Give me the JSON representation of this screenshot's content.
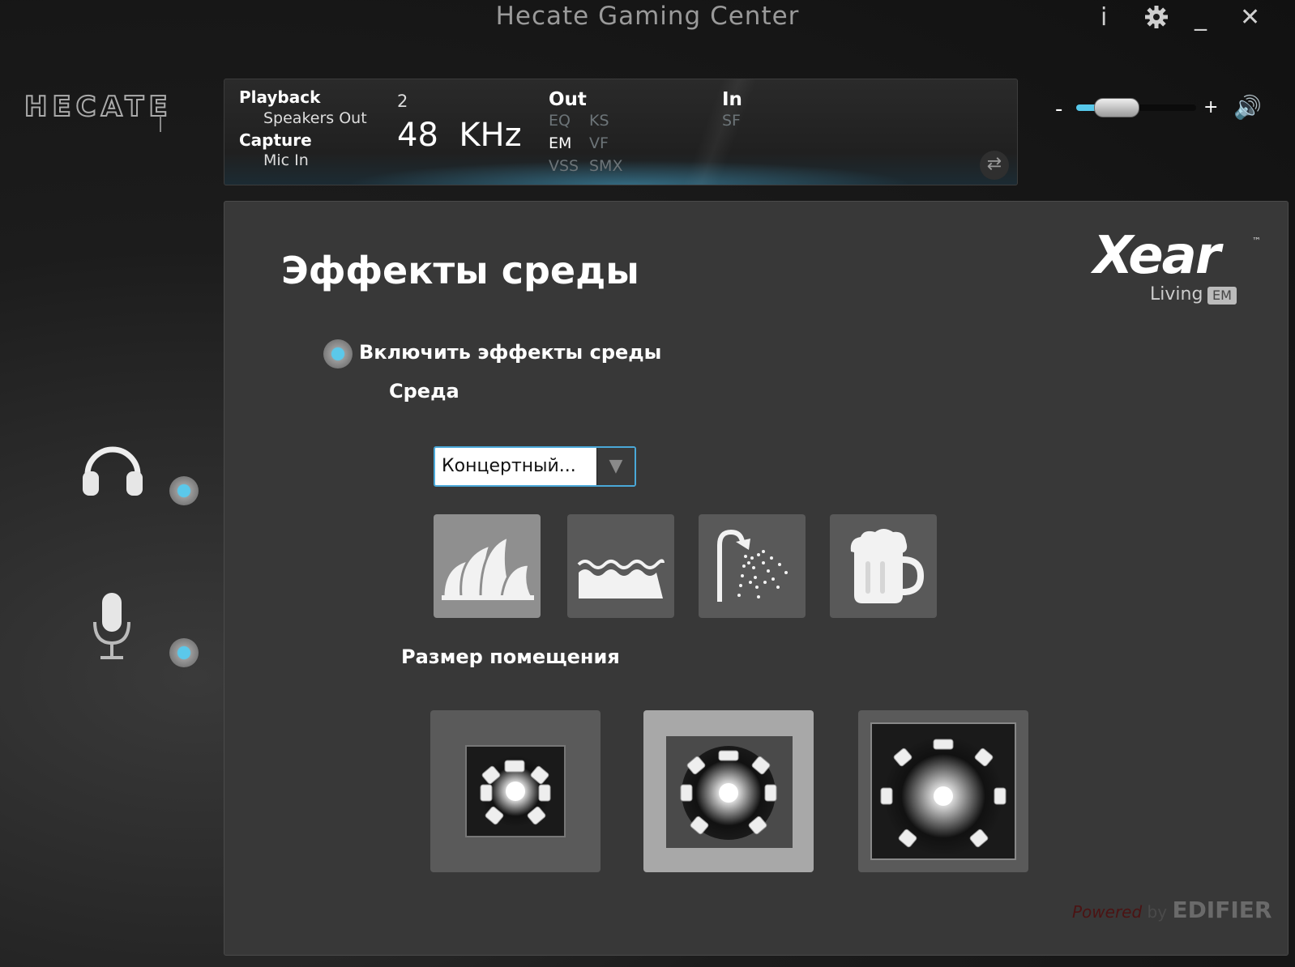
{
  "window": {
    "title": "Hecate Gaming Center",
    "controls": {
      "info": "i",
      "minimize": "_",
      "close": "✕"
    }
  },
  "brand": {
    "logo_text": "HECATE"
  },
  "status": {
    "playback_label": "Playback",
    "playback_device": "Speakers Out",
    "capture_label": "Capture",
    "capture_device": "Mic In",
    "channels": "2",
    "sample_rate": "48  KHz",
    "out_label": "Out",
    "out_effects": [
      "EQ",
      "KS",
      "EM",
      "VF",
      "VSS",
      "SMX"
    ],
    "out_active": [
      "EM"
    ],
    "in_label": "In",
    "in_effects": [
      "SF"
    ]
  },
  "volume": {
    "minus": "-",
    "plus": "+",
    "level": 0.2
  },
  "main": {
    "title": "Эффекты среды",
    "xear": {
      "logo": "Xear",
      "tm": "™",
      "living": "Living",
      "em": "EM"
    },
    "enable_label": "Включить эффекты среды",
    "environment_label": "Среда",
    "dropdown_value": "Концертный...",
    "environments": [
      "opera-house-icon",
      "water-icon",
      "shower-icon",
      "beer-mug-icon"
    ],
    "selected_environment": 0,
    "room_size_label": "Размер помещения",
    "room_sizes": [
      "small-room-icon",
      "medium-room-icon",
      "large-room-icon"
    ],
    "selected_room_size": 1,
    "powered_by": {
      "powered": "Powered",
      "by": " by ",
      "brand": "EDIFIER"
    }
  },
  "colors": {
    "accent": "#57c8ea",
    "panel": "#383838",
    "tile": "#595959",
    "tile_active": "#8f8f8f"
  }
}
